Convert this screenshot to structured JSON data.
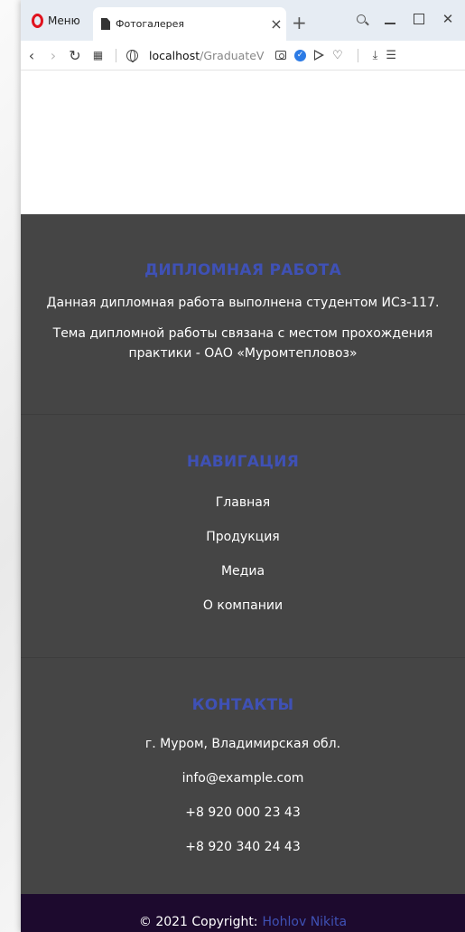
{
  "browser": {
    "menu_label": "Меню",
    "tab_title": "Фотогалерея",
    "tab_close": "×",
    "new_tab": "+",
    "url_host": "localhost",
    "url_path": "/GraduateV"
  },
  "footer": {
    "about": {
      "title": "Дипломная работа",
      "line1": "Данная дипломная работа выполнена студентом ИСз-117.",
      "line2": "Тема дипломной работы связана с местом прохождения практики - ОАО «Муромтепловоз»"
    },
    "navigation": {
      "title": "Навигация",
      "items": [
        "Главная",
        "Продукция",
        "Медиа",
        "О компании"
      ]
    },
    "contacts": {
      "title": "Контакты",
      "address": "г. Муром, Владимирская обл.",
      "email": "info@example.com",
      "phone1": "+8 920 000 23 43",
      "phone2": "+8 920 340 24 43"
    },
    "copyright": {
      "text": "© 2021 Copyright:",
      "author": "Hohlov Nikita"
    }
  },
  "colors": {
    "footer_bg": "#454545",
    "accent_title": "#3f51b5",
    "copyright_bg": "#1d0a2e"
  }
}
